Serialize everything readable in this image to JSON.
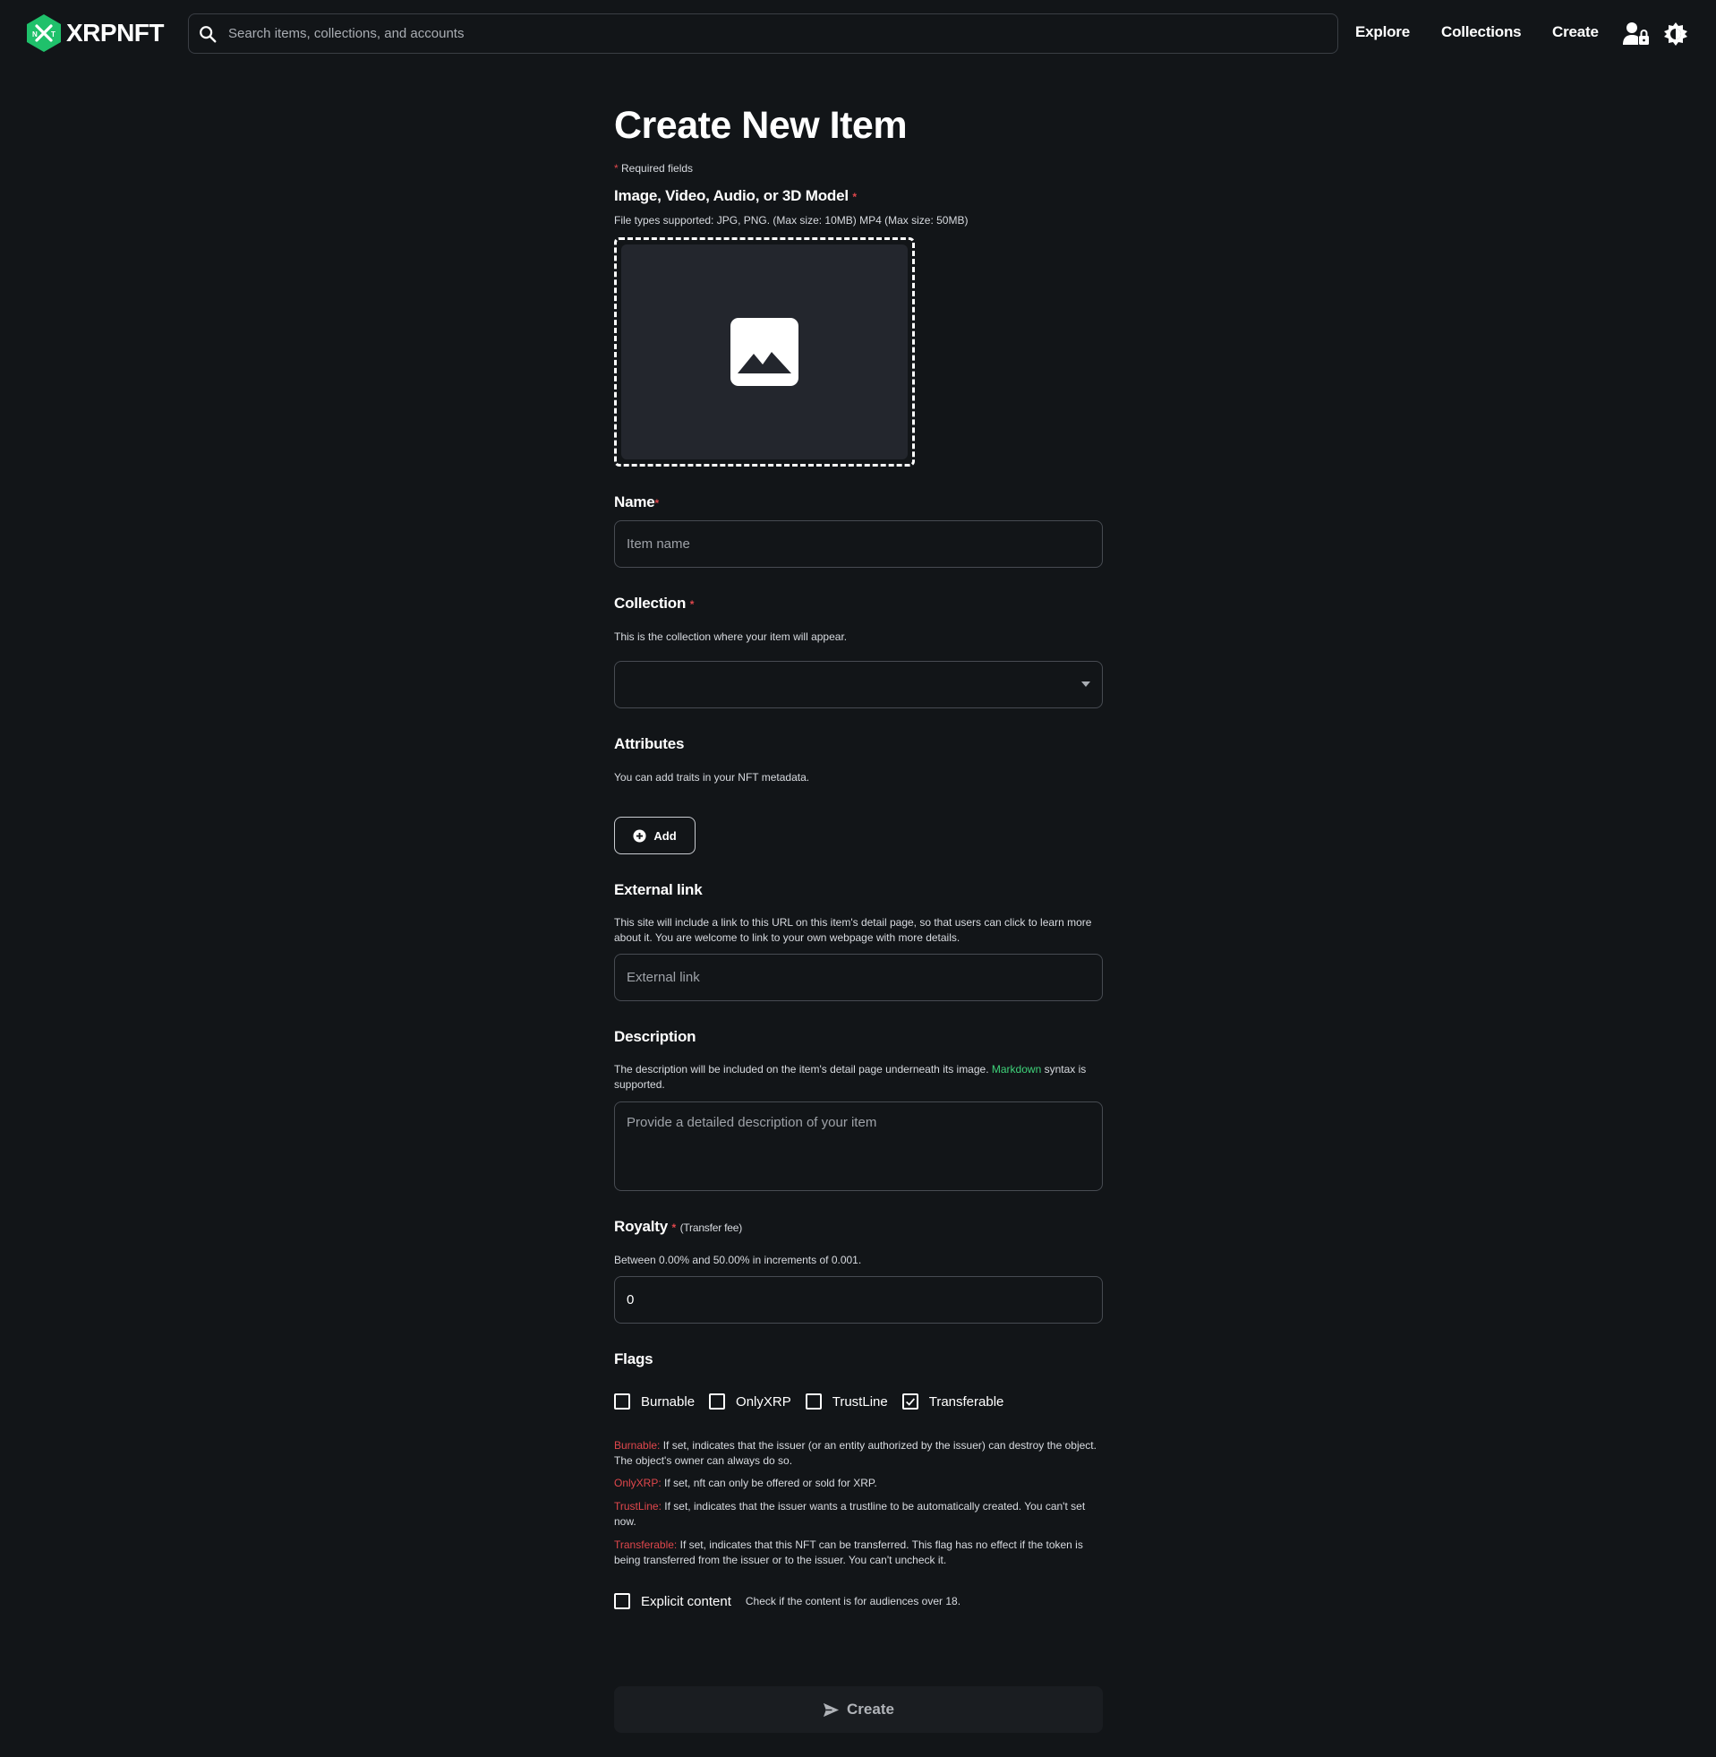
{
  "header": {
    "logo_text": "XRPNFT",
    "search_placeholder": "Search items, collections, and accounts",
    "nav": {
      "explore": "Explore",
      "collections": "Collections",
      "create": "Create"
    },
    "icons": [
      "search-icon",
      "account-lock-icon",
      "theme-toggle-icon"
    ],
    "brand_color": "#1fc16b"
  },
  "form": {
    "title": "Create New Item",
    "required_star": "*",
    "required_note": "Required fields",
    "media": {
      "label": "Image, Video, Audio, or 3D Model",
      "helper": "File types supported: JPG, PNG. (Max size: 10MB) MP4 (Max size: 50MB)",
      "icon": "image-placeholder-icon"
    },
    "name": {
      "label": "Name",
      "placeholder": "Item name"
    },
    "collection": {
      "label": "Collection",
      "helper": "This is the collection where your item will appear.",
      "selected": ""
    },
    "attributes": {
      "label": "Attributes",
      "helper": "You can add traits in your NFT metadata.",
      "add_label": "Add"
    },
    "external_link": {
      "label": "External link",
      "helper": "This site will include a link to this URL on this item's detail page, so that users can click to learn more about it. You are welcome to link to your own webpage with more details.",
      "placeholder": "External link"
    },
    "description": {
      "label": "Description",
      "helper_before": "The description will be included on the item's detail page underneath its image.",
      "markdown_link": "Markdown",
      "helper_after": "syntax is supported.",
      "placeholder": "Provide a detailed description of your item"
    },
    "royalty": {
      "label": "Royalty",
      "sublabel": "(Transfer fee)",
      "helper": "Between 0.00% and 50.00% in increments of 0.001.",
      "value": "0"
    },
    "flags": {
      "label": "Flags",
      "items": [
        {
          "label": "Burnable",
          "checked": false
        },
        {
          "label": "OnlyXRP",
          "checked": false
        },
        {
          "label": "TrustLine",
          "checked": false
        },
        {
          "label": "Transferable",
          "checked": true
        }
      ],
      "descriptions": [
        {
          "name": "Burnable:",
          "text": "If set, indicates that the issuer (or an entity authorized by the issuer) can destroy the object. The object's owner can always do so."
        },
        {
          "name": "OnlyXRP:",
          "text": "If set, nft can only be offered or sold for XRP."
        },
        {
          "name": "TrustLine:",
          "text": "If set, indicates that the issuer wants a trustline to be automatically created. You can't set now."
        },
        {
          "name": "Transferable:",
          "text": "If set, indicates that this NFT can be transferred. This flag has no effect if the token is being transferred from the issuer or to the issuer. You can't uncheck it."
        }
      ]
    },
    "explicit": {
      "label": "Explicit content",
      "note": "Check if the content is for audiences over 18.",
      "checked": false
    },
    "submit_label": "Create"
  }
}
